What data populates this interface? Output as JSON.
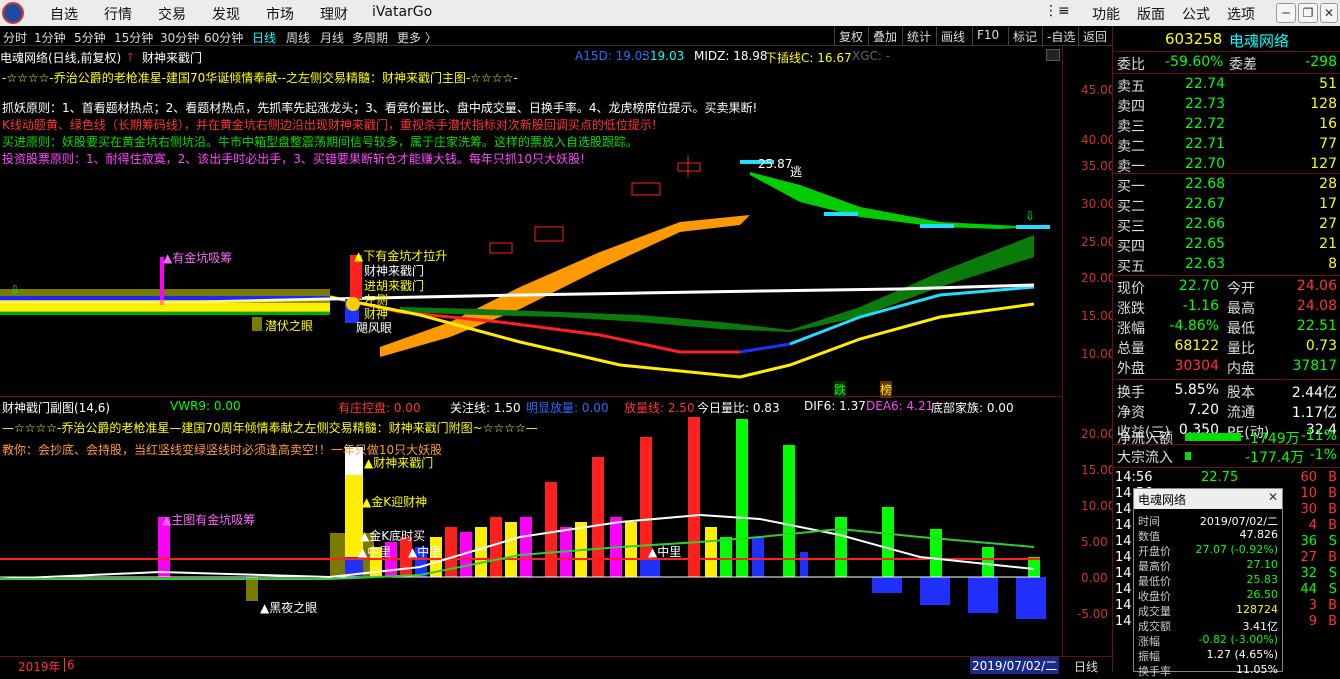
{
  "menu": {
    "items": [
      "自选",
      "行情",
      "交易",
      "发现",
      "市场",
      "理财",
      "iVatarGo"
    ],
    "right": [
      "功能",
      "版面",
      "公式",
      "选项"
    ]
  },
  "periods": [
    "分时",
    "1分钟",
    "5分钟",
    "15分钟",
    "30分钟",
    "60分钟",
    "日线",
    "周线",
    "月线",
    "多周期",
    "更多"
  ],
  "active_period": "日线",
  "toolbar": [
    "复权",
    "叠加",
    "统计",
    "画线",
    "F10",
    "标记",
    "-自选",
    "返回"
  ],
  "main": {
    "stock_title": "电魂网络(日线,前复权)",
    "indicator": "财神来戳门",
    "a15d_label": "A15D: 19.03",
    "a15d_val": ": 19.03",
    "midz": "MIDZ: 18.98",
    "xiachaxian": "下插线C: 16.67",
    "xgc": "XGC: -",
    "line1": "-☆☆☆☆-乔治公爵的老枪准星-建国70华诞倾情奉献--之左侧交易精髓：财神来戳门主图-☆☆☆☆-",
    "line2": "抓妖原则：1、首看题材热点；2、看题材热点，先抓率先起涨龙头；3、看竞价量比、盘中成交量、日换手率。4、龙虎榜席位提示。买卖果断!",
    "line3": "K线动题黄、绿色线（长期筹码线），并在黄金坑右侧边沿出现财神来戳门，重视杀手潜伏指标对次新股回调买点的低位提示!",
    "line4": "买进原则：妖股要买在黄金坑右侧坑沿。牛市中箱型盘整震荡期间信号较多，属于庄家洗筹。这样的票放入自选股跟踪。",
    "line5": "投资股票原则：1、耐得住寂寞，2、该出手时必出手，3、买错要果断斩仓才能赚大钱。每年只抓10只大妖股!",
    "ann_huangjin": "▲有金坑吸筹",
    "ann_xiayou": "▲下有金坑才拉升",
    "ann_caishen": "财神来戳门",
    "ann_jinghu": "进胡来戳门",
    "ann_zuoce": "左侧",
    "ann_caishen2": "财神",
    "ann_qianfu": "潜伏之眼",
    "ann_jufeng": "飓风眼",
    "ann_high": "25.87",
    "ann_tao": "逃",
    "ann_die": "跌",
    "ann_bang": "榜",
    "yticks": [
      "45.00",
      "40.00",
      "35.00",
      "30.00",
      "25.00",
      "20.00",
      "15.00",
      "10.00"
    ]
  },
  "sub": {
    "title": "财神戳门副图(14,6)",
    "vwr9": "VWR9: 0.00",
    "zhuang": "有庄控盘: 0.00",
    "guanzhu": "关注线: 1.50",
    "mingxian": "明显放量: 0.00",
    "fangliang": "放量线: 2.50",
    "liangbi": "今日量比: 0.83",
    "dif6": "DIF6: 1.37",
    "dea6": "DEA6: 4.21",
    "dibu": "底部家族: 0.00",
    "line1": "—☆☆☆☆-乔治公爵的老枪准星—建国70周年倾情奉献之左侧交易精髓：财神来戳门附图~☆☆☆☆—",
    "line2": "教你：会抄底、会持股，当红竖线变绿竖线时必须逢高卖空!！一年只做10只大妖股",
    "ann_zhutu": "▲主图有金坑吸筹",
    "ann_caishen": "▲财神来戳门",
    "ann_jink": "▲金K迎财神",
    "ann_jindi": "▲金K底时买",
    "ann_zm1": "▲中里",
    "ann_zm2": "▲中里",
    "ann_zm3": "▲中里",
    "ann_heiye": "▲黑夜之眼",
    "yticks": [
      "20.00",
      "15.00",
      "10.00",
      "5.00",
      "0.00",
      "-5.00"
    ]
  },
  "bottom": {
    "year": "2019年",
    "month": "6",
    "date": "2019/07/02/二",
    "tab": "日线"
  },
  "quote": {
    "code": "603258",
    "name": "电魂网络",
    "weibi_label": "委比",
    "weibi": "-59.60%",
    "weicha_label": "委差",
    "weicha": "-298",
    "asks": [
      {
        "label": "卖五",
        "price": "22.74",
        "vol": "51"
      },
      {
        "label": "卖四",
        "price": "22.73",
        "vol": "128"
      },
      {
        "label": "卖三",
        "price": "22.72",
        "vol": "16"
      },
      {
        "label": "卖二",
        "price": "22.71",
        "vol": "77"
      },
      {
        "label": "卖一",
        "price": "22.70",
        "vol": "127"
      }
    ],
    "bids": [
      {
        "label": "买一",
        "price": "22.68",
        "vol": "28"
      },
      {
        "label": "买二",
        "price": "22.67",
        "vol": "17"
      },
      {
        "label": "买三",
        "price": "22.66",
        "vol": "27"
      },
      {
        "label": "买四",
        "price": "22.65",
        "vol": "21"
      },
      {
        "label": "买五",
        "price": "22.63",
        "vol": "8"
      }
    ],
    "stats": [
      {
        "l1": "现价",
        "v1": "22.70",
        "c1": "green",
        "l2": "今开",
        "v2": "24.06",
        "c2": "red"
      },
      {
        "l1": "涨跌",
        "v1": "-1.16",
        "c1": "green",
        "l2": "最高",
        "v2": "24.08",
        "c2": "red"
      },
      {
        "l1": "涨幅",
        "v1": "-4.86%",
        "c1": "green",
        "l2": "最低",
        "v2": "22.51",
        "c2": "green"
      },
      {
        "l1": "总量",
        "v1": "68122",
        "c1": "yellow",
        "l2": "量比",
        "v2": "0.73",
        "c2": "yellow"
      },
      {
        "l1": "外盘",
        "v1": "30304",
        "c1": "red",
        "l2": "内盘",
        "v2": "37817",
        "c2": "green"
      }
    ],
    "stats2": [
      {
        "l1": "换手",
        "v1": "5.85%",
        "l2": "股本",
        "v2": "2.44亿"
      },
      {
        "l1": "净资",
        "v1": "7.20",
        "l2": "流通",
        "v2": "1.17亿"
      },
      {
        "l1": "收益(三)",
        "v1": "0.350",
        "l2": "PE(动)",
        "v2": "32.4"
      }
    ],
    "jlr_label": "净流入额",
    "jlr": "-1749万",
    "jlr_pct": "-11%",
    "dz_label": "大宗流入",
    "dz": "-177.4万",
    "dz_pct": "-1%",
    "ticks": [
      {
        "t": "14:56",
        "p": "22.75",
        "v": "60",
        "s": "B"
      },
      {
        "t": "14:56",
        "p": "",
        "v": "10",
        "s": "B"
      },
      {
        "t": "14:56",
        "p": "",
        "v": "30",
        "s": "B"
      },
      {
        "t": "14:56",
        "p": "",
        "v": "4",
        "s": "B"
      },
      {
        "t": "14:56",
        "p": "",
        "v": "36",
        "s": "S"
      },
      {
        "t": "14:56",
        "p": "",
        "v": "27",
        "s": "B"
      },
      {
        "t": "14:56",
        "p": "",
        "v": "32",
        "s": "S"
      },
      {
        "t": "14:56",
        "p": "",
        "v": "44",
        "s": "S"
      },
      {
        "t": "14:56",
        "p": "",
        "v": "3",
        "s": "B"
      },
      {
        "t": "14:56",
        "p": "",
        "v": "9",
        "s": "B"
      }
    ]
  },
  "popup": {
    "title": "电魂网络",
    "rows": [
      {
        "k": "时间",
        "v": "2019/07/02/二",
        "c": "white"
      },
      {
        "k": "数值",
        "v": "47.826",
        "c": "white"
      },
      {
        "k": "开盘价",
        "v": "27.07 (-0.92%)",
        "c": "green"
      },
      {
        "k": "最高价",
        "v": "27.10",
        "c": "green"
      },
      {
        "k": "最低价",
        "v": "25.83",
        "c": "green"
      },
      {
        "k": "收盘价",
        "v": "26.50",
        "c": "green"
      },
      {
        "k": "成交量",
        "v": "128724",
        "c": "yellow"
      },
      {
        "k": "成交额",
        "v": "3.41亿",
        "c": "white"
      },
      {
        "k": "涨幅",
        "v": "-0.82 (-3.00%)",
        "c": "green"
      },
      {
        "k": "振幅",
        "v": "1.27 (4.65%)",
        "c": "white"
      },
      {
        "k": "换手率",
        "v": "11.05%",
        "c": "white"
      }
    ]
  }
}
